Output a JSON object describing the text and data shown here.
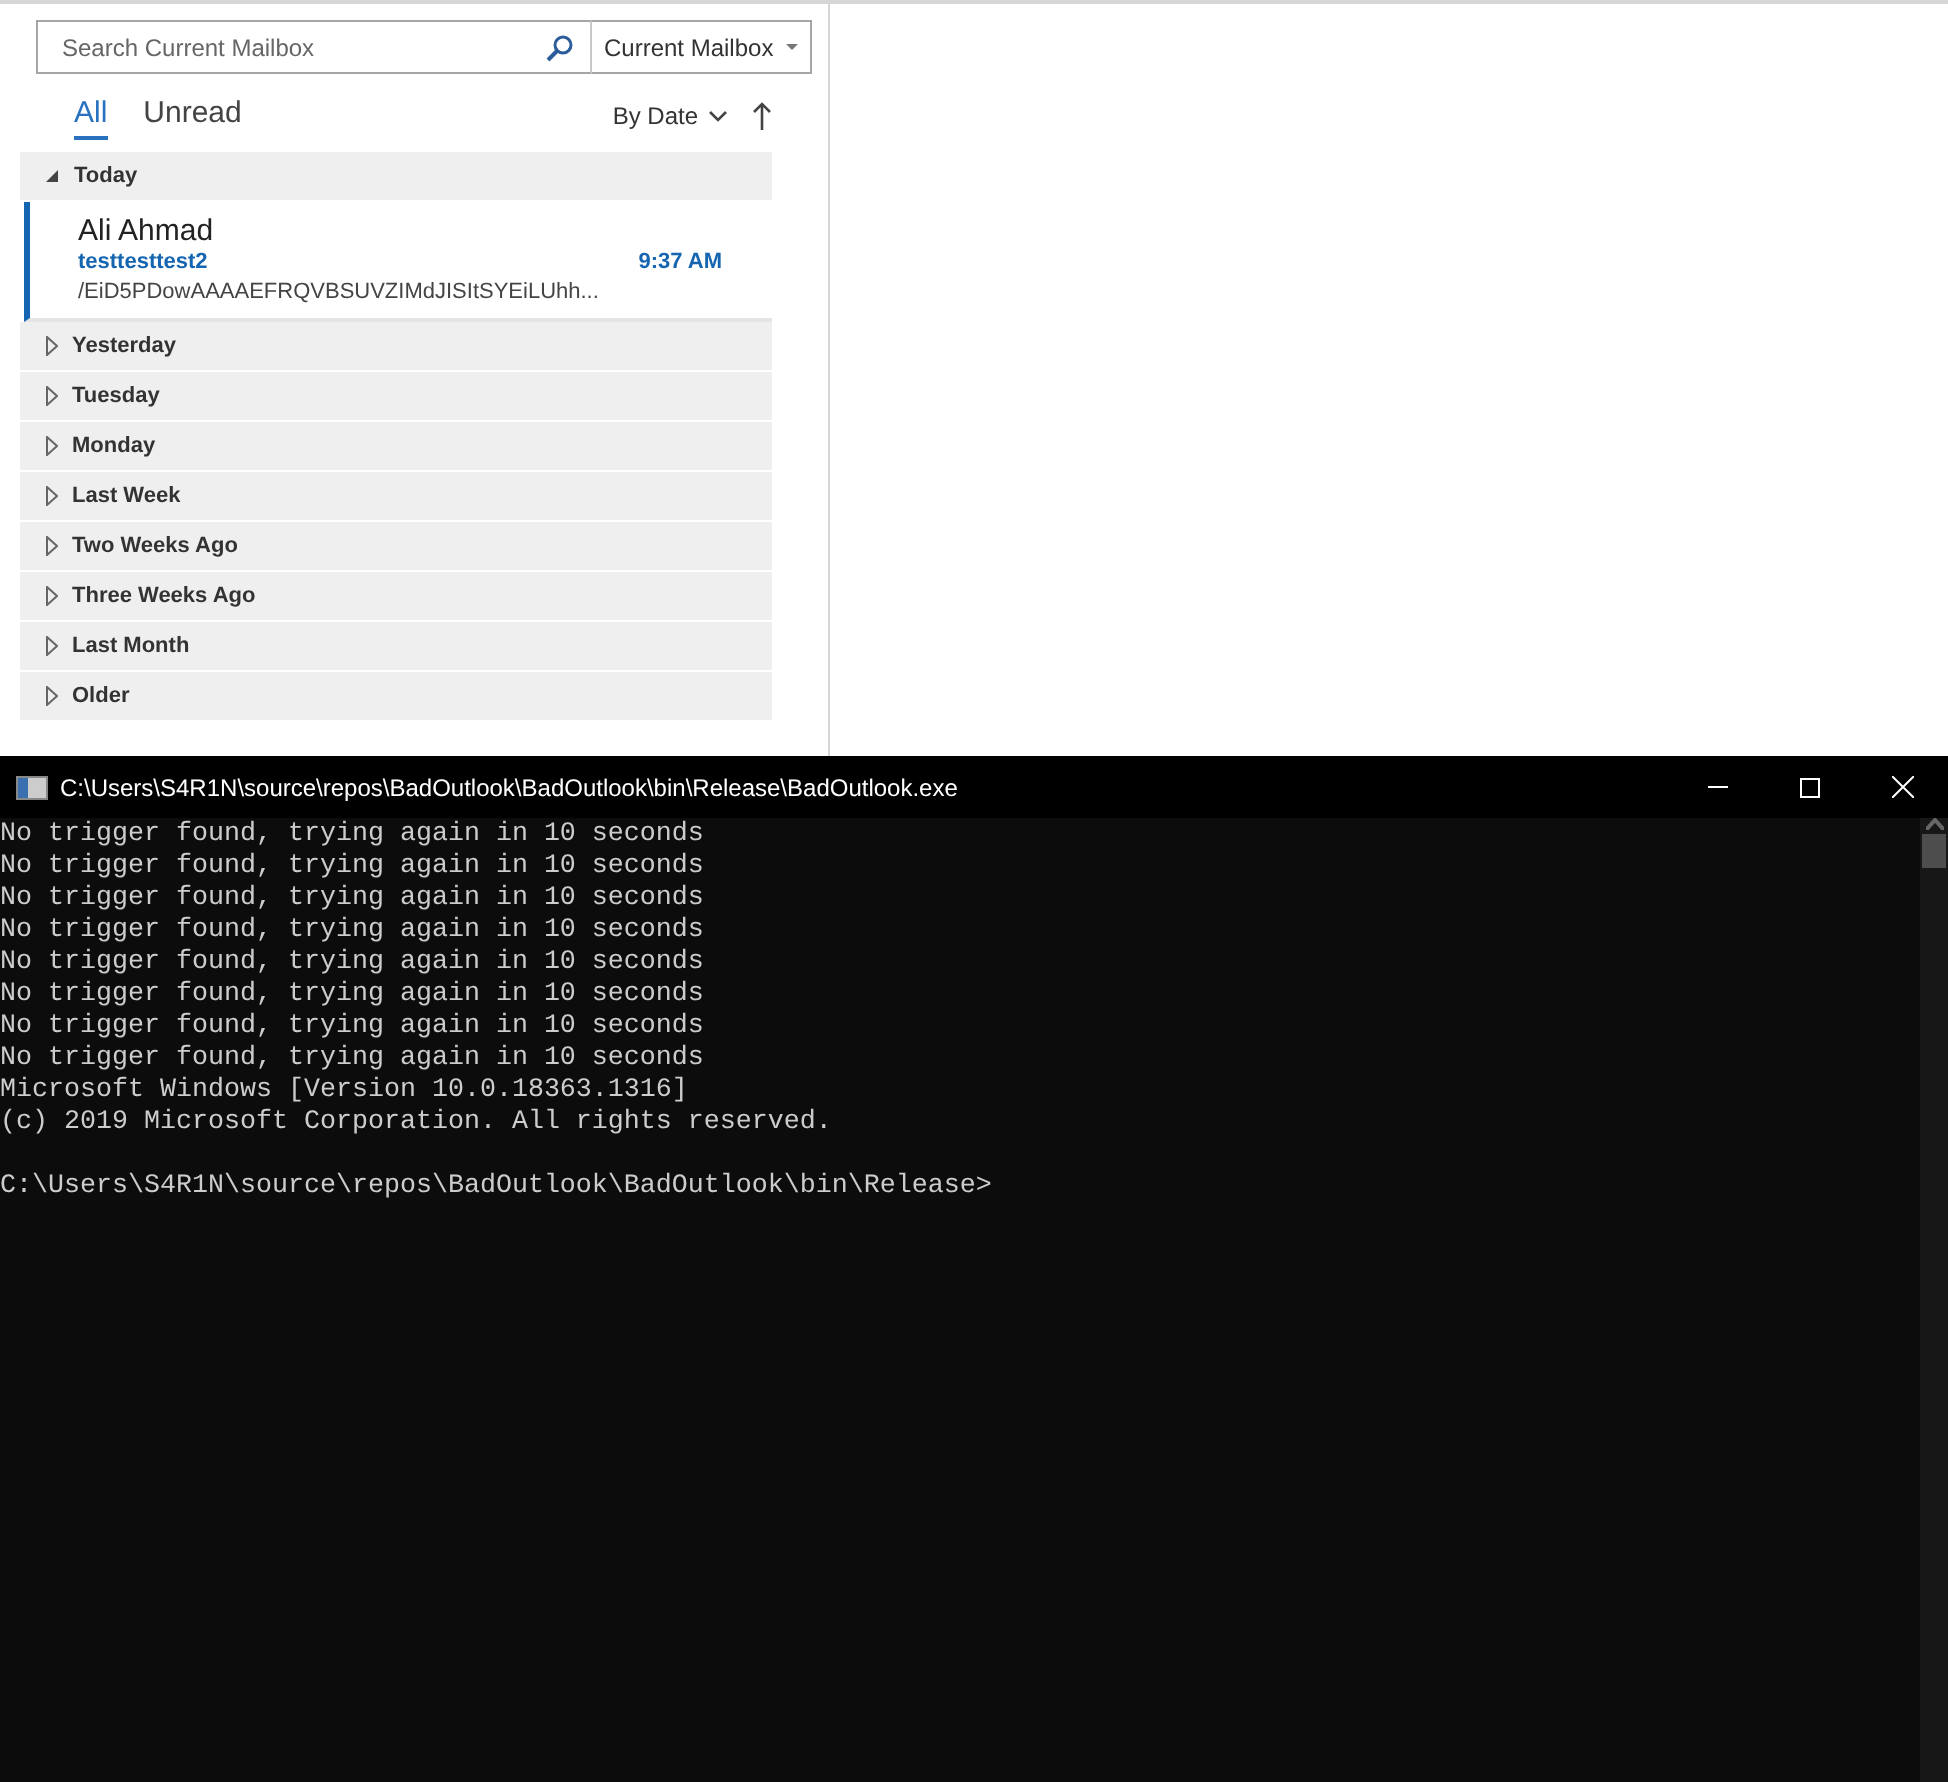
{
  "mail_list": {
    "search": {
      "placeholder": "Search Current Mailbox"
    },
    "scope": "Current Mailbox",
    "filters": [
      {
        "label": "All",
        "selected": true
      },
      {
        "label": "Unread",
        "selected": false
      }
    ],
    "sort": "By Date",
    "groups": [
      {
        "label": "Today",
        "expanded": true,
        "messages": [
          {
            "sender": "Ali Ahmad",
            "subject": "testtesttest2",
            "time": "9:37 AM",
            "preview": "/EiD5PDowAAAAEFRQVBSUVZIMdJISItSYEiLUhh...",
            "selected": true,
            "unread": true
          }
        ]
      },
      {
        "label": "Yesterday",
        "expanded": false
      },
      {
        "label": "Tuesday",
        "expanded": false
      },
      {
        "label": "Monday",
        "expanded": false
      },
      {
        "label": "Last Week",
        "expanded": false
      },
      {
        "label": "Two Weeks Ago",
        "expanded": false
      },
      {
        "label": "Three Weeks Ago",
        "expanded": false
      },
      {
        "label": "Last Month",
        "expanded": false
      },
      {
        "label": "Older",
        "expanded": false
      }
    ]
  },
  "console": {
    "title": "C:\\Users\\S4R1N\\source\\repos\\BadOutlook\\BadOutlook\\bin\\Release\\BadOutlook.exe",
    "output": [
      "No trigger found, trying again in 10 seconds",
      "No trigger found, trying again in 10 seconds",
      "No trigger found, trying again in 10 seconds",
      "No trigger found, trying again in 10 seconds",
      "No trigger found, trying again in 10 seconds",
      "No trigger found, trying again in 10 seconds",
      "No trigger found, trying again in 10 seconds",
      "No trigger found, trying again in 10 seconds",
      "Microsoft Windows [Version 10.0.18363.1316]",
      "(c) 2019 Microsoft Corporation. All rights reserved."
    ],
    "prompt": "C:\\Users\\S4R1N\\source\\repos\\BadOutlook\\BadOutlook\\bin\\Release>"
  }
}
